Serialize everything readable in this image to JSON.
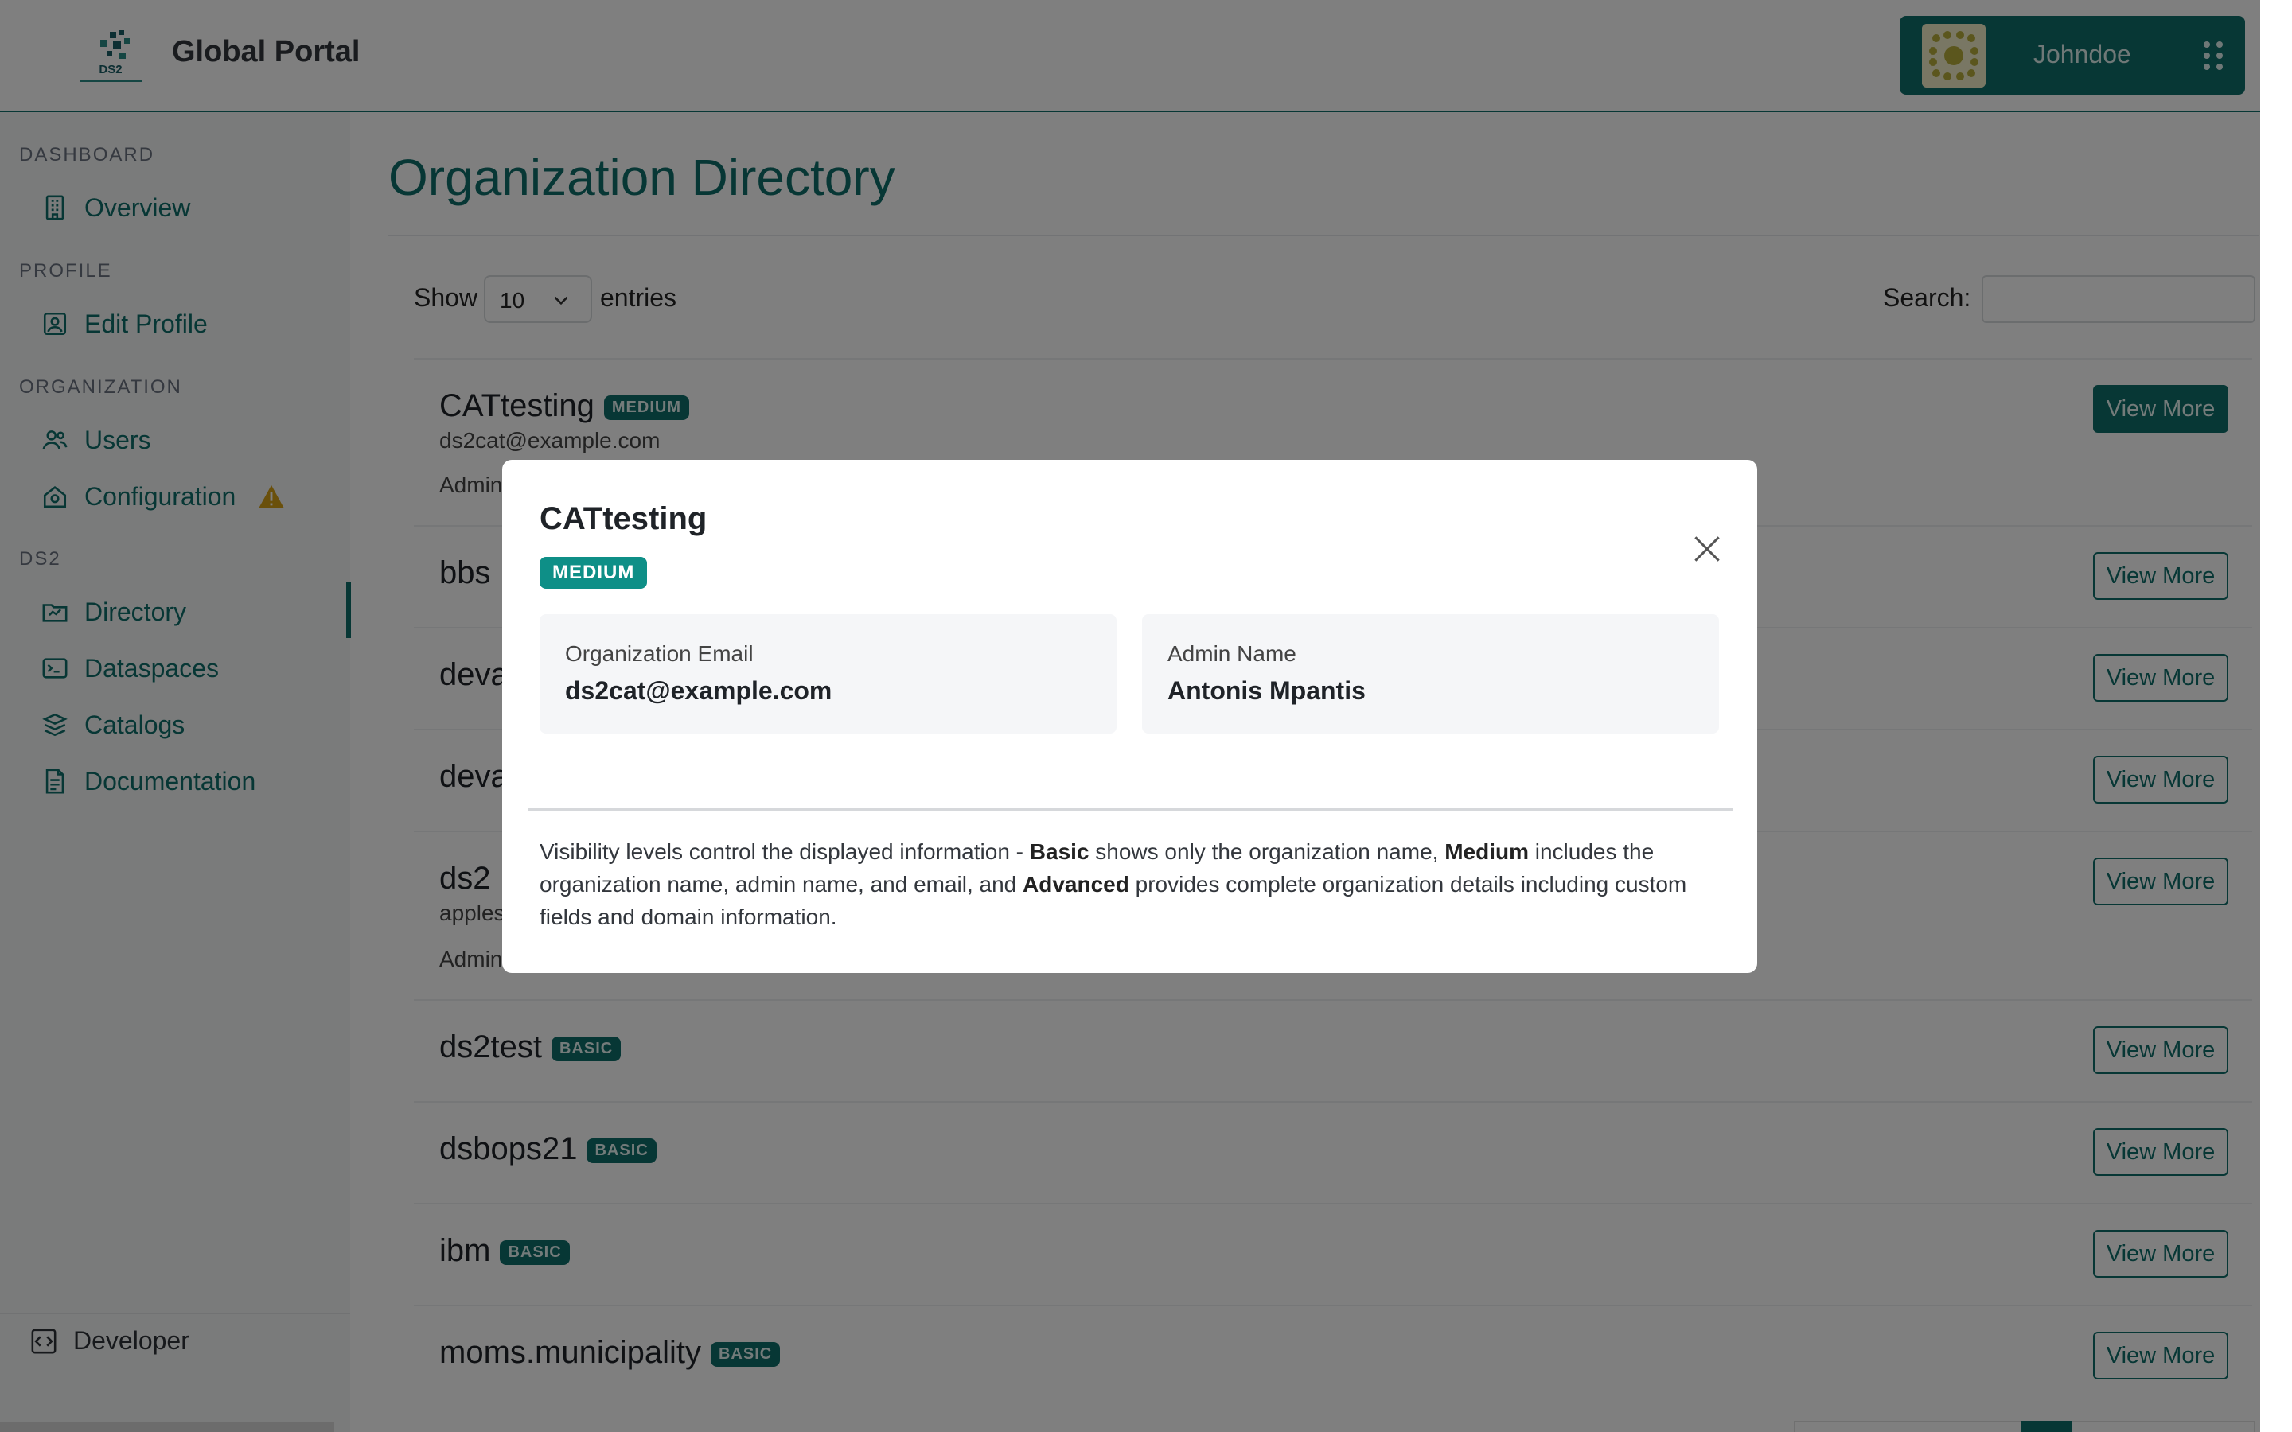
{
  "header": {
    "logo_text": "DS2",
    "title": "Global Portal",
    "user_name": "Johndoe"
  },
  "sidebar": {
    "sections": [
      {
        "label": "DASHBOARD",
        "items": [
          {
            "label": "Overview",
            "icon": "building-icon"
          }
        ]
      },
      {
        "label": "PROFILE",
        "items": [
          {
            "label": "Edit Profile",
            "icon": "profile-card-icon"
          }
        ]
      },
      {
        "label": "ORGANIZATION",
        "items": [
          {
            "label": "Users",
            "icon": "users-icon"
          },
          {
            "label": "Configuration",
            "icon": "gear-icon",
            "warning": true
          }
        ]
      },
      {
        "label": "DS2",
        "items": [
          {
            "label": "Directory",
            "icon": "folder-icon",
            "active": true
          },
          {
            "label": "Dataspaces",
            "icon": "terminal-icon"
          },
          {
            "label": "Catalogs",
            "icon": "catalog-icon"
          },
          {
            "label": "Documentation",
            "icon": "document-icon"
          }
        ]
      }
    ],
    "developer_label": "Developer",
    "warning_color": "#d4a017"
  },
  "main": {
    "page_title": "Organization Directory",
    "show_label": "Show",
    "entries_value": "10",
    "entries_label": "entries",
    "search_label": "Search:",
    "view_more_label": "View More",
    "rows": [
      {
        "name": "CATtesting",
        "badge": "MEDIUM",
        "email": "ds2cat@example.com",
        "admin": "Admin"
      },
      {
        "name": "bbs"
      },
      {
        "name": "deva"
      },
      {
        "name": "deva"
      },
      {
        "name": "ds2",
        "email": "apples",
        "admin": "Admin"
      },
      {
        "name": "ds2test",
        "badge": "BASIC"
      },
      {
        "name": "dsbops21",
        "badge": "BASIC"
      },
      {
        "name": "ibm",
        "badge": "BASIC"
      },
      {
        "name": "moms.municipality",
        "badge": "BASIC"
      }
    ]
  },
  "modal": {
    "title": "CATtesting",
    "badge": "MEDIUM",
    "email_label": "Organization Email",
    "email_value": "ds2cat@example.com",
    "admin_label": "Admin Name",
    "admin_value": "Antonis Mpantis",
    "note": {
      "p1": "Visibility levels control the displayed information - ",
      "b1": "Basic",
      "p2": " shows only the organization name, ",
      "b2": "Medium",
      "p3": " includes the organization name, admin name, and email, and ",
      "b3": "Advanced",
      "p4": " provides complete organization details including custom fields and domain information."
    }
  },
  "colors": {
    "primary": "#0e6e6a",
    "badge_modal": "#0e8f87"
  }
}
